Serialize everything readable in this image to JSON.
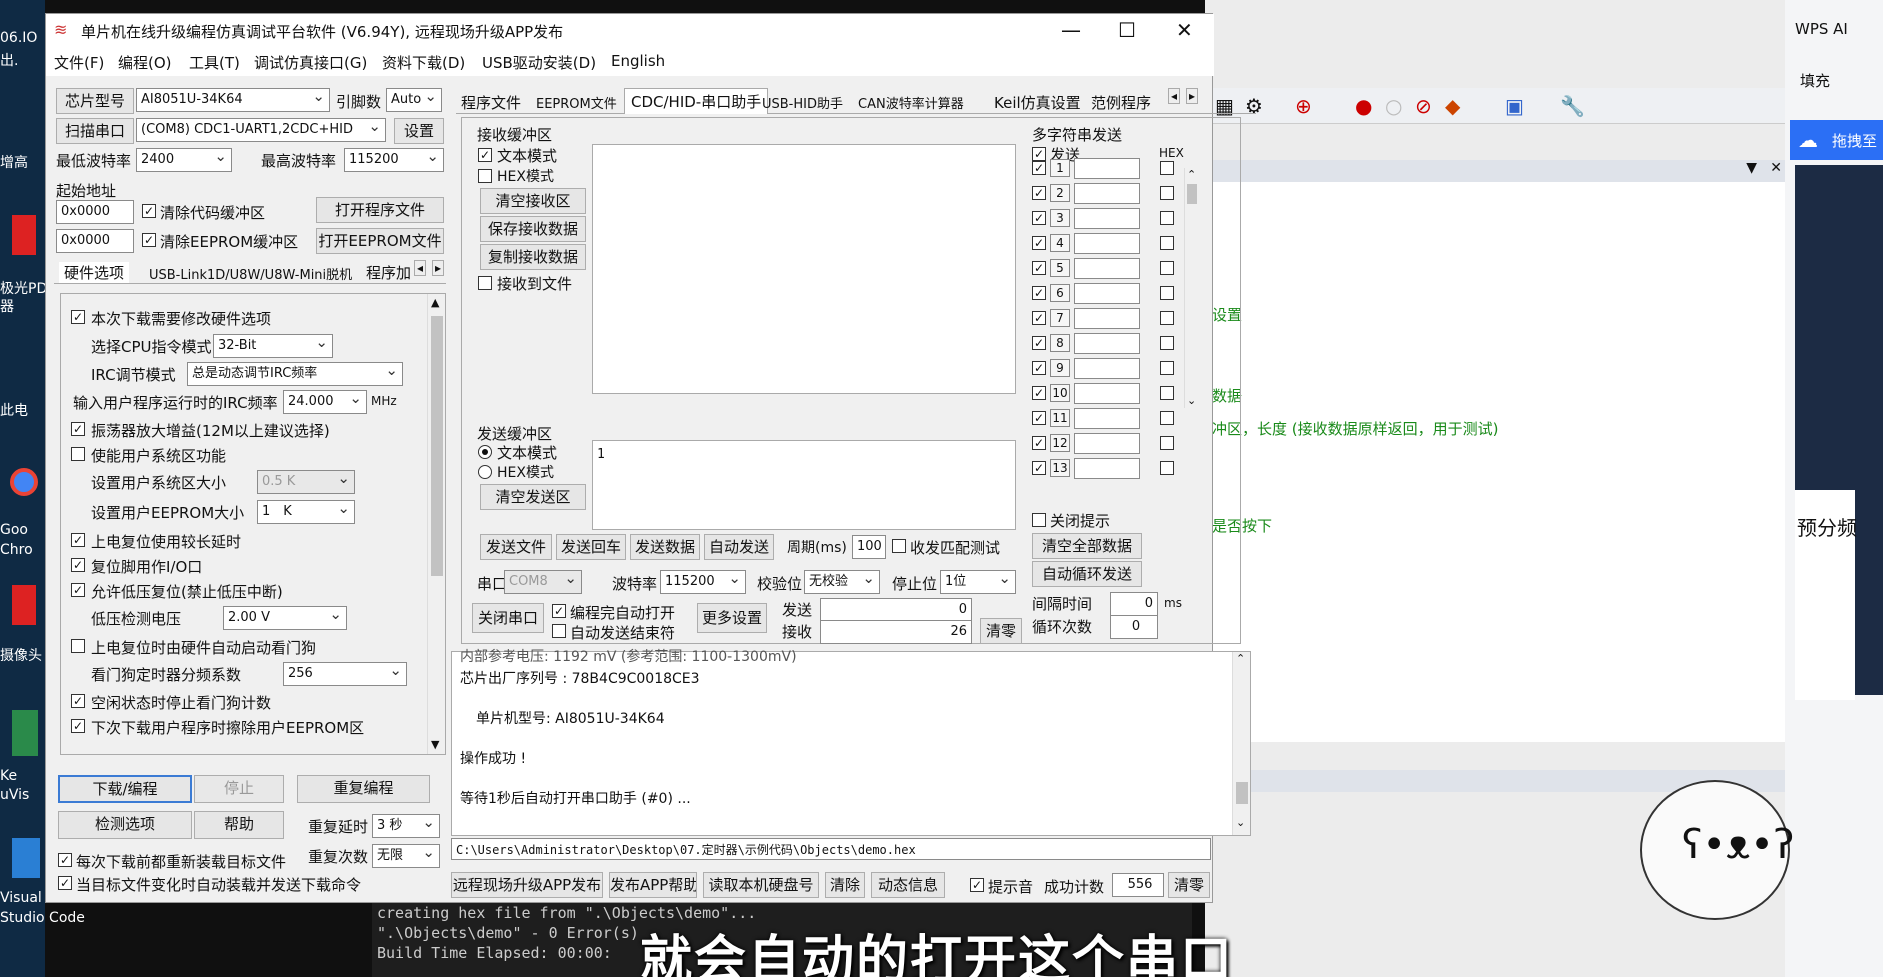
{
  "desktop": {
    "labels": [
      "06.IO",
      "出.",
      "增高",
      "极光PD",
      "器",
      "此电",
      "Goo",
      "Chro",
      "摄像头",
      "Ke",
      "uVis",
      "Visual",
      "Studio Code"
    ]
  },
  "window": {
    "title": "单片机在线升级编程仿真调试平台软件 (V6.94Y), 远程现场升级APP发布",
    "minimize": "—",
    "maximize": "☐",
    "close": "✕"
  },
  "menu": [
    "文件(F)",
    "编程(O)",
    "工具(T)",
    "调试仿真接口(G)",
    "资料下载(D)",
    "USB驱动安装(D)",
    "English"
  ],
  "left": {
    "chip_label": "芯片型号",
    "chip_value": "AI8051U-34K64",
    "pin_label": "引脚数",
    "pin_value": "Auto",
    "scan_btn": "扫描串口",
    "port_value": "(COM8) CDC1-UART1,2CDC+HID",
    "settings_btn": "设置",
    "min_baud_label": "最低波特率",
    "min_baud": "2400",
    "max_baud_label": "最高波特率",
    "max_baud": "115200",
    "start_addr_label": "起始地址",
    "addr1": "0x0000",
    "clear_code": "清除代码缓冲区",
    "open_prog": "打开程序文件",
    "addr2": "0x0000",
    "clear_eeprom": "清除EEPROM缓冲区",
    "open_eeprom": "打开EEPROM文件",
    "tabs": [
      "硬件选项",
      "USB-Link1D/U8W/U8W-Mini脱机",
      "程序加"
    ],
    "opt_modify": "本次下载需要修改硬件选项",
    "cpu_mode_label": "选择CPU指令模式",
    "cpu_mode": "32-Bit",
    "irc_mode_label": "IRC调节模式",
    "irc_mode": "总是动态调节IRC频率",
    "irc_freq_label": "输入用户程序运行时的IRC频率",
    "irc_freq": "24.000",
    "irc_unit": "MHz",
    "osc_gain": "振荡器放大增益(12M以上建议选择)",
    "user_sys": "使能用户系统区功能",
    "sys_size_label": "设置用户系统区大小",
    "sys_size": "0.5 K",
    "eeprom_size_label": "设置用户EEPROM大小",
    "eeprom_size": "1　K",
    "long_delay": "上电复位使用较长延时",
    "reset_io": "复位脚用作I/O口",
    "lvr": "允许低压复位(禁止低压中断)",
    "lv_label": "低压检测电压",
    "lv_value": "2.00 V",
    "wdt": "上电复位时由硬件自动启动看门狗",
    "wdt_div_label": "看门狗定时器分频系数",
    "wdt_div": "256",
    "idle_wdt": "空闲状态时停止看门狗计数",
    "erase_eeprom": "下次下载用户程序时擦除用户EEPROM区",
    "download_btn": "下载/编程",
    "stop_btn": "停止",
    "reprog_btn": "重复编程",
    "check_btn": "检测选项",
    "help_btn": "帮助",
    "delay_label": "重复延时",
    "delay_value": "3 秒",
    "reload": "每次下载前都重新装载目标文件",
    "count_label": "重复次数",
    "count_value": "无限",
    "auto_send": "当目标文件变化时自动装载并发送下载命令"
  },
  "right_tabs": [
    "程序文件",
    "EEPROM文件",
    "CDC/HID-串口助手",
    "USB-HID助手",
    "CAN波特率计算器",
    "Keil仿真设置",
    "范例程序"
  ],
  "serial": {
    "recv_group": "接收缓冲区",
    "text_mode": "文本模式",
    "hex_mode": "HEX模式",
    "clear_recv": "清空接收区",
    "save_recv": "保存接收数据",
    "copy_recv": "复制接收数据",
    "recv_file": "接收到文件",
    "send_group": "发送缓冲区",
    "send_text_mode": "文本模式",
    "send_hex_mode": "HEX模式",
    "clear_send": "清空发送区",
    "send_content": "1",
    "send_file": "发送文件",
    "send_cr": "发送回车",
    "send_data": "发送数据",
    "auto_send": "自动发送",
    "period_label": "周期(ms)",
    "period": "100",
    "match_test": "收发匹配测试",
    "port_label": "串口",
    "port": "COM8",
    "baud_label": "波特率",
    "baud": "115200",
    "parity_label": "校验位",
    "parity": "无校验",
    "stop_label": "停止位",
    "stop": "1位",
    "close_port": "关闭串口",
    "auto_open": "编程完自动打开",
    "auto_end": "自动发送结束符",
    "more": "更多设置",
    "sent_label": "发送",
    "sent": "0",
    "recv_label": "接收",
    "recv": "26",
    "clear": "清零"
  },
  "multi": {
    "title": "多字符串发送",
    "send": "发送",
    "hex": "HEX",
    "rows": [
      "1",
      "2",
      "3",
      "4",
      "5",
      "6",
      "7",
      "8",
      "9",
      "10",
      "11",
      "12",
      "13"
    ],
    "close_tip": "关闭提示",
    "clear_all": "清空全部数据",
    "auto_loop": "自动循环发送",
    "interval_label": "间隔时间",
    "interval": "0",
    "interval_unit": "ms",
    "loop_label": "循环次数",
    "loop": "0"
  },
  "log": {
    "lines": [
      "内部参考电压: 1192 mV (参考范围: 1100-1300mV)",
      "芯片出厂序列号 : 78B4C9C0018CE3",
      "",
      "单片机型号: AI8051U-34K64",
      "",
      "操作成功 !",
      "",
      "等待1秒后自动打开串口助手 (#0) ..."
    ]
  },
  "path": "C:\\Users\\Administrator\\Desktop\\07.定时器\\示例代码\\Objects\\demo.hex",
  "bottom": {
    "remote": "远程现场升级APP发布",
    "app_help": "发布APP帮助",
    "read_disk": "读取本机硬盘号",
    "clear": "清除",
    "dynamic": "动态信息",
    "beep": "提示音",
    "success_label": "成功计数",
    "success": "556",
    "zero": "清零"
  },
  "bg": {
    "code_lines": [
      "设置",
      "数据",
      "冲区，长度 (接收数据原样返回，用于测试)",
      "是否按下"
    ],
    "wps_title": "WPS AI",
    "wps_fill": "填充",
    "wps_drag": "拖拽至",
    "wps_side": "预分频"
  },
  "build": {
    "lines": [
      "creating hex file from \".\\Objects\\demo\"...",
      "\".\\Objects\\demo\" - 0 Error(s)",
      "Build Time Elapsed:  00:00:"
    ]
  },
  "subtitle": "就会自动的打开这个串口"
}
